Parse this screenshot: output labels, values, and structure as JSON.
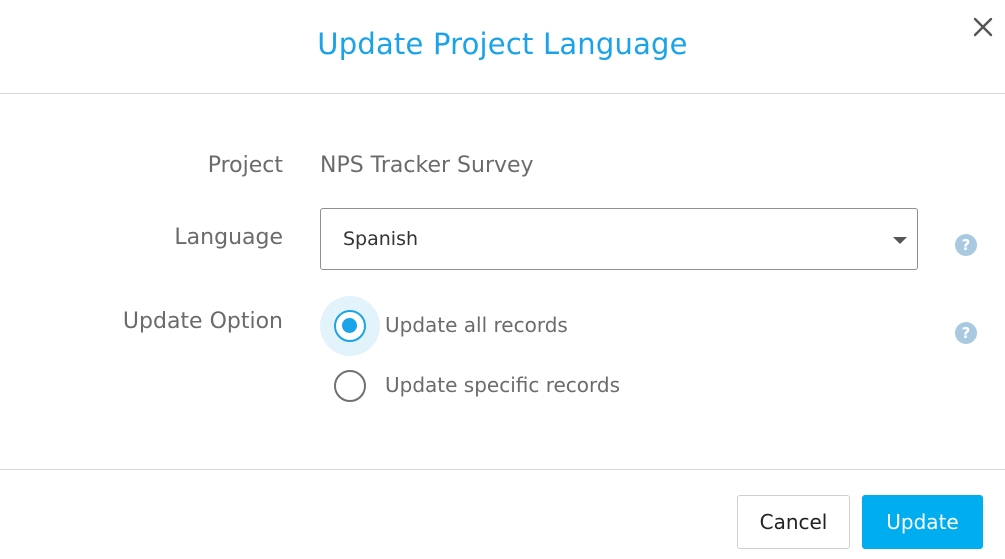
{
  "dialog": {
    "title": "Update Project Language"
  },
  "form": {
    "project_label": "Project",
    "project_value": "NPS Tracker Survey",
    "language_label": "Language",
    "language_selected": "Spanish",
    "update_option_label": "Update Option",
    "options": [
      {
        "label": "Update all records",
        "checked": true
      },
      {
        "label": "Update specific records",
        "checked": false
      }
    ]
  },
  "icons": {
    "close": "close-icon",
    "help": "help-icon",
    "help_glyph": "?"
  },
  "footer": {
    "cancel_label": "Cancel",
    "update_label": "Update"
  },
  "colors": {
    "accent": "#1aa3e8",
    "primary_button": "#00adef",
    "help_icon": "#a9c9e0",
    "selected_halo": "#e3f3fc"
  }
}
